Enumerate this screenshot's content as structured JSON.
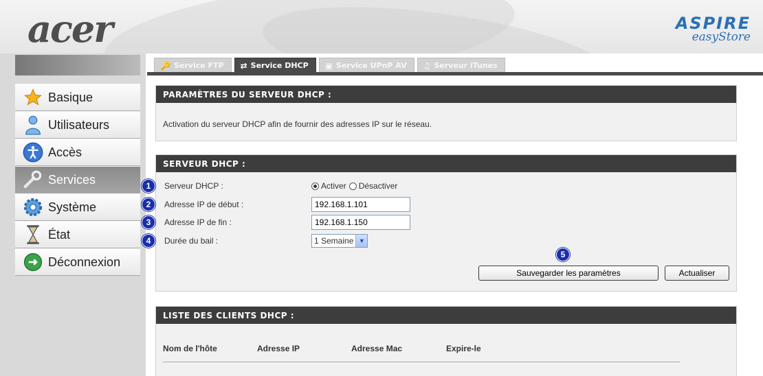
{
  "header": {
    "logo": "acer",
    "brand_line1": "ASPIRE",
    "brand_line2": "easyStore"
  },
  "tabs": [
    {
      "label": "Service FTP",
      "icon": "key-icon",
      "active": false
    },
    {
      "label": "Service DHCP",
      "icon": "network-icon",
      "active": true
    },
    {
      "label": "Service UPnP AV",
      "icon": "media-icon",
      "active": false
    },
    {
      "label": "Serveur iTunes",
      "icon": "music-icon",
      "active": false
    }
  ],
  "sidebar": {
    "items": [
      {
        "label": "Basique",
        "icon": "star-icon"
      },
      {
        "label": "Utilisateurs",
        "icon": "user-icon"
      },
      {
        "label": "Accès",
        "icon": "accessibility-icon"
      },
      {
        "label": "Services",
        "icon": "wrench-icon",
        "active": true
      },
      {
        "label": "Système",
        "icon": "gear-icon"
      },
      {
        "label": "État",
        "icon": "hourglass-icon"
      },
      {
        "label": "Déconnexion",
        "icon": "logout-icon"
      }
    ]
  },
  "settings_panel": {
    "title": "PARAMÈTRES DU SERVEUR DHCP :",
    "description": "Activation du serveur DHCP afin de fournir des adresses IP sur le réseau."
  },
  "dhcp_panel": {
    "title": "SERVEUR DHCP :",
    "fields": [
      {
        "badge": "1",
        "label": "Serveur DHCP :"
      },
      {
        "badge": "2",
        "label": "Adresse IP de début :",
        "value": "192.168.1.101"
      },
      {
        "badge": "3",
        "label": "Adresse IP de fin :",
        "value": "192.168.1.150"
      },
      {
        "badge": "4",
        "label": "Durée du bail :",
        "value": "1 Semaine"
      }
    ],
    "radio_on": "Activer",
    "radio_off": "Désactiver",
    "save_badge": "5",
    "save_label": "Sauvegarder les paramètres",
    "refresh_label": "Actualiser"
  },
  "clients_panel": {
    "title": "LISTE DES CLIENTS DHCP :",
    "columns": [
      "Nom de l'hôte",
      "Adresse IP",
      "Adresse Mac",
      "Expire-le"
    ]
  },
  "colors": {
    "header_dark": "#3d3d3d",
    "badge_blue": "#1a2ea8",
    "panel_bg": "#f1f1f1",
    "sidebar_bg": "#d9d9d9"
  }
}
